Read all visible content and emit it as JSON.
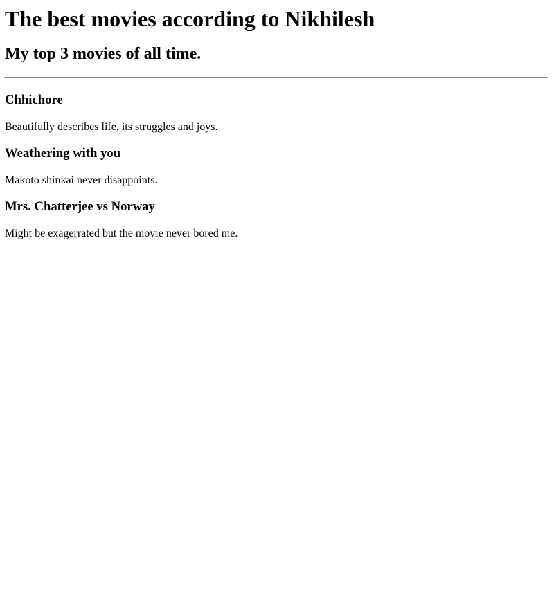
{
  "page": {
    "title": "The best movies according to Nikhilesh",
    "subtitle": "My top 3 movies of all time."
  },
  "movies": [
    {
      "name": "Chhichore",
      "description": "Beautifully describes life, its struggles and joys."
    },
    {
      "name": "Weathering with you",
      "description": "Makoto shinkai never disappoints."
    },
    {
      "name": "Mrs. Chatterjee vs Norway",
      "description": "Might be exagerrated but the movie never bored me."
    }
  ]
}
